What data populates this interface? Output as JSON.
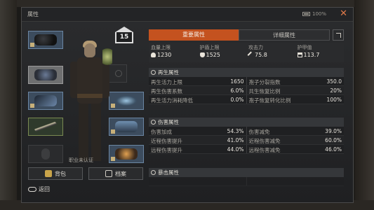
{
  "window": {
    "title": "属性",
    "battery": "100%",
    "close": "✕"
  },
  "character": {
    "level": "15",
    "job_status": "职业未认证"
  },
  "buttons": {
    "backpack": "背包",
    "archive": "档案",
    "back": "返回"
  },
  "tabs": [
    {
      "label": "重要属性",
      "active": true
    },
    {
      "label": "详细属性",
      "active": false
    }
  ],
  "summary": [
    {
      "label": "血量上限",
      "value": "1230",
      "icon": "heart-icon"
    },
    {
      "label": "护盾上限",
      "value": "1525",
      "icon": "shield-icon"
    },
    {
      "label": "攻击力",
      "value": "75.8",
      "icon": "sword-icon"
    },
    {
      "label": "护甲值",
      "value": "113.7",
      "icon": "armor-icon"
    }
  ],
  "sections": [
    {
      "title": "再生属性",
      "rows": [
        [
          {
            "k": "再生活力上限",
            "v": "1650"
          },
          {
            "k": "孢子分裂指数",
            "v": "350.0"
          }
        ],
        [
          {
            "k": "再生伤害系数",
            "v": "6.0%"
          },
          {
            "k": "共生恢复比例",
            "v": "20%"
          }
        ],
        [
          {
            "k": "再生活力消耗降低",
            "v": "0.0%"
          },
          {
            "k": "孢子恢复转化比例",
            "v": "100%"
          }
        ]
      ]
    },
    {
      "title": "伤害属性",
      "rows": [
        [
          {
            "k": "伤害加成",
            "v": "54.3%"
          },
          {
            "k": "伤害减免",
            "v": "39.0%"
          }
        ],
        [
          {
            "k": "近程伤害提升",
            "v": "41.0%"
          },
          {
            "k": "近程伤害减免",
            "v": "60.0%"
          }
        ],
        [
          {
            "k": "远程伤害提升",
            "v": "44.0%"
          },
          {
            "k": "远程伤害减免",
            "v": "46.0%"
          }
        ]
      ]
    },
    {
      "title": "暴击属性",
      "rows": []
    }
  ],
  "colors": {
    "accent": "#c4521f",
    "slot_blue": "#3c4c5e"
  }
}
